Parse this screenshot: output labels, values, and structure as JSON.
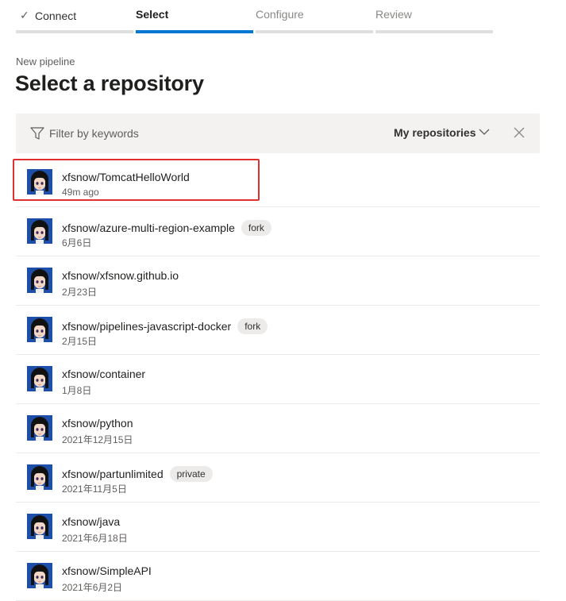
{
  "wizard": {
    "steps": [
      {
        "label": "Connect",
        "state": "done"
      },
      {
        "label": "Select",
        "state": "active"
      },
      {
        "label": "Configure",
        "state": "pending"
      },
      {
        "label": "Review",
        "state": "pending"
      }
    ]
  },
  "header": {
    "subtitle": "New pipeline",
    "title": "Select a repository"
  },
  "filter": {
    "placeholder": "Filter by keywords",
    "scope": "My repositories"
  },
  "repos": [
    {
      "name": "xfsnow/TomcatHelloWorld",
      "date": "49m ago",
      "badge": "",
      "highlighted": true
    },
    {
      "name": "xfsnow/azure-multi-region-example",
      "date": "6月6日",
      "badge": "fork"
    },
    {
      "name": "xfsnow/xfsnow.github.io",
      "date": "2月23日",
      "badge": ""
    },
    {
      "name": "xfsnow/pipelines-javascript-docker",
      "date": "2月15日",
      "badge": "fork"
    },
    {
      "name": "xfsnow/container",
      "date": "1月8日",
      "badge": ""
    },
    {
      "name": "xfsnow/python",
      "date": "2021年12月15日",
      "badge": ""
    },
    {
      "name": "xfsnow/partunlimited",
      "date": "2021年11月5日",
      "badge": "private"
    },
    {
      "name": "xfsnow/java",
      "date": "2021年6月18日",
      "badge": ""
    },
    {
      "name": "xfsnow/SimpleAPI",
      "date": "2021年6月2日",
      "badge": ""
    }
  ],
  "colors": {
    "accent": "#0078d4",
    "highlight_box": "#e03131",
    "avatar_bg": "#1e4fa8"
  },
  "icons": {
    "step_done": "checkmark-icon",
    "filter": "funnel-icon",
    "scope_dropdown": "chevron-down-icon",
    "clear": "close-icon",
    "repo_avatar": "avatar"
  }
}
